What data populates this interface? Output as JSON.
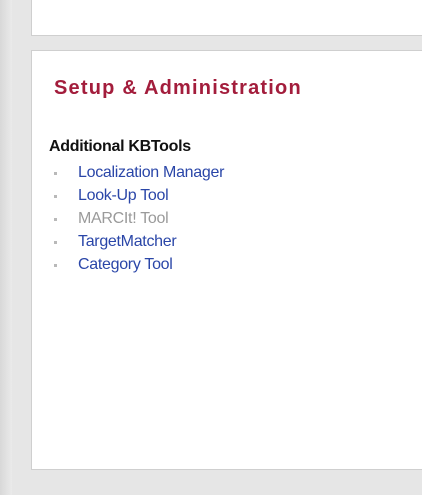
{
  "card": {
    "title": "Setup & Administration",
    "section_heading": "Additional KBTools",
    "items": [
      {
        "label": "Localization Manager",
        "enabled": true
      },
      {
        "label": "Look-Up Tool",
        "enabled": true
      },
      {
        "label": "MARCIt! Tool",
        "enabled": false
      },
      {
        "label": "TargetMatcher",
        "enabled": true
      },
      {
        "label": "Category Tool",
        "enabled": true
      }
    ]
  },
  "colors": {
    "title": "#a31d3c",
    "link": "#2a46a8",
    "disabled": "#9a9a9a",
    "heading": "#111111"
  },
  "icons": {
    "bullet": "square-bullet-icon"
  }
}
